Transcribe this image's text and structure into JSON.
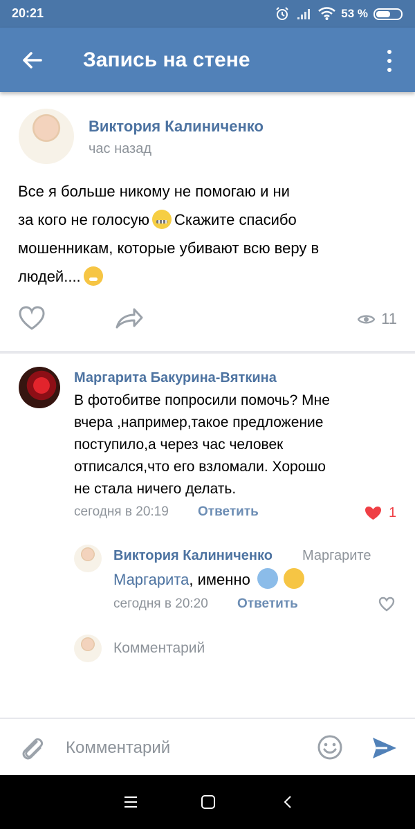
{
  "status": {
    "time": "20:21",
    "battery": "53 %"
  },
  "header": {
    "title": "Запись на стене"
  },
  "post": {
    "author": "Виктория Калиниченко",
    "time": "час назад",
    "text_line_1": "Все я больше никому не помогаю и ни",
    "text_line_2_before": "за кого не голосую",
    "text_line_2_after": "Скажите спасибо",
    "text_line_3": "мошенникам, которые убивают всю веру в",
    "text_line_4": "людей....",
    "views": "11"
  },
  "comment": {
    "author": "Маргарита Бакурина-Вяткина",
    "line_1": "В фотобитве попросили помочь? Мне",
    "line_2": "вчера ,например,такое предложение",
    "line_3": "поступило,а через час человек",
    "line_4": "отписался,что его взломали. Хорошо",
    "line_5": "не стала ничего делать.",
    "time": "сегодня в 20:19",
    "reply": "Ответить",
    "likes": "1"
  },
  "reply": {
    "author": "Виктория Калиниченко",
    "to": "Маргарите",
    "mention": "Маргарита",
    "text": ", именно",
    "time": "сегодня в 20:20",
    "reply_action": "Ответить"
  },
  "comment_prompt": {
    "label": "Комментарий"
  },
  "composer": {
    "placeholder": "Комментарий"
  },
  "icons": {
    "back": "arrow-left-icon",
    "more": "more-vertical-icon",
    "like": "heart-icon",
    "share": "share-icon",
    "views": "eye-icon",
    "attach": "paperclip-icon",
    "emoji": "smile-icon",
    "send": "send-icon",
    "nav_menu": "menu-icon",
    "nav_home": "square-home-icon",
    "nav_back": "chevron-left-icon"
  },
  "colors": {
    "vk_blue": "#5181b8",
    "link_blue": "#4d73a1",
    "muted": "#8d939a",
    "like_red": "#ef3f45"
  }
}
